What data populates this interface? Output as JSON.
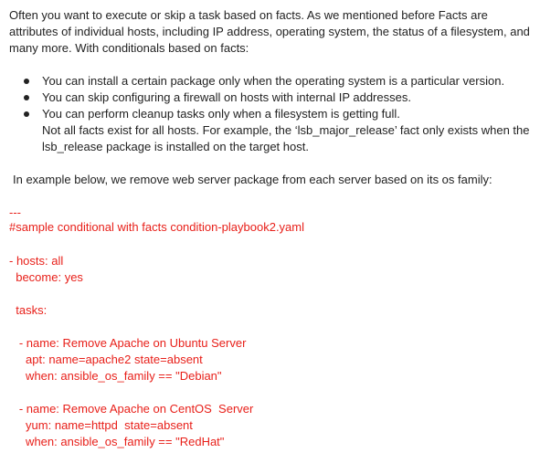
{
  "intro": "Often you want to execute or skip a task based on facts. As we mentioned before Facts are attributes of individual hosts, including IP address, operating system, the status of a filesystem, and many more. With conditionals based on facts:",
  "bullets": [
    "You can install a certain package only when the operating system is a particular version.",
    "You can skip configuring a firewall on hosts with internal IP addresses.",
    "You can perform cleanup tasks only when a filesystem is getting full."
  ],
  "note": "Not all facts exist for all hosts. For example, the ‘lsb_major_release’ fact only exists when the lsb_release package is installed on the target host.",
  "example_intro": "In example below, we remove web server package from each server based on its os family:",
  "code": {
    "doc_start": "---",
    "comment": "#sample conditional with facts condition-playbook2.yaml",
    "hosts": "- hosts: all",
    "become": "  become: yes",
    "tasks": "  tasks:",
    "task1_name": "   - name: Remove Apache on Ubuntu Server",
    "task1_apt": "     apt: name=apache2 state=absent",
    "task1_when": "     when: ansible_os_family == \"Debian\"",
    "task2_name": "   - name: Remove Apache on CentOS  Server",
    "task2_yum": "     yum: name=httpd  state=absent",
    "task2_when": "     when: ansible_os_family == \"RedHat\""
  },
  "colors": {
    "text": "#222222",
    "code": "#e8201a",
    "background": "#ffffff"
  }
}
